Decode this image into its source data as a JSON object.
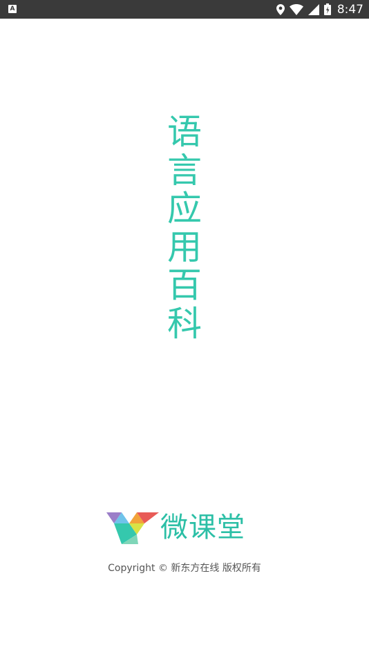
{
  "status_bar": {
    "left_icon": "A",
    "icons": [
      "location-icon",
      "wifi-icon",
      "signal-icon",
      "battery-icon"
    ],
    "time": "8:47"
  },
  "splash": {
    "title_chars": [
      "语",
      "言",
      "应",
      "用",
      "百",
      "科"
    ],
    "accent_color": "#35c8ad"
  },
  "brand": {
    "name": "微课堂",
    "logo_colors": [
      "#9b7ec8",
      "#6fc3ea",
      "#f2a33a",
      "#e85b57",
      "#35c8ad",
      "#d9e245"
    ]
  },
  "footer": {
    "copyright": "Copyright © 新东方在线 版权所有"
  }
}
